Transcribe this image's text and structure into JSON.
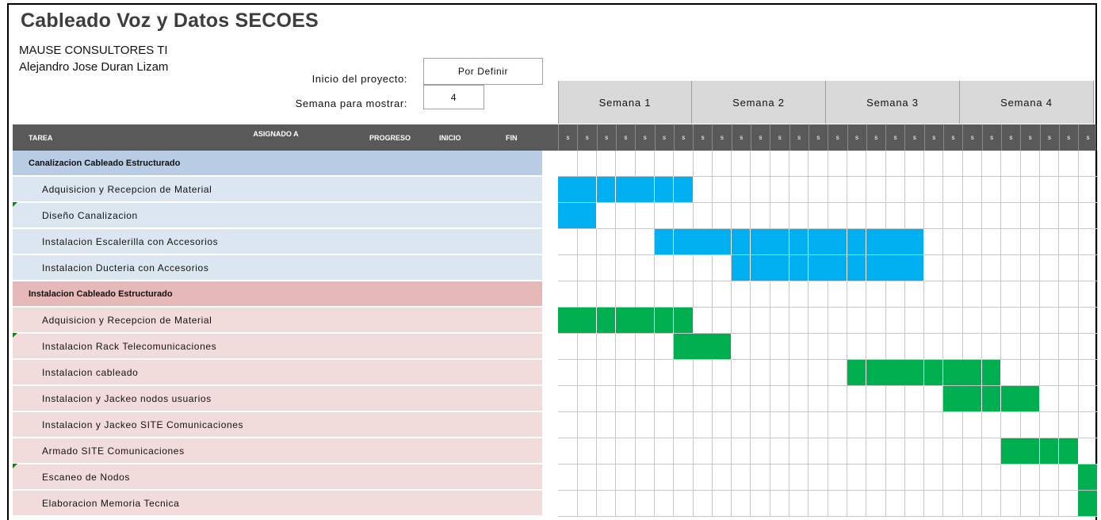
{
  "sheet": {
    "title": "Cableado Voz y Datos SECOES",
    "company": "MAUSE CONSULTORES TI",
    "manager": "Alejandro Jose Duran Lizam",
    "start_label": "Inicio del proyecto:",
    "start_value": "Por Definir",
    "week_label": "Semana para mostrar:",
    "week_value": "4"
  },
  "weeks": [
    "Semana 1",
    "Semana 2",
    "Semana 3",
    "Semana 4"
  ],
  "day_letter": "s",
  "columns": {
    "task": "TAREA",
    "assigned": "ASIGNADO A",
    "progress": "PROGRESO",
    "start": "INICIO",
    "end": "FIN"
  },
  "colors": {
    "blue_bar": "#00b0f0",
    "green_bar": "#00b050",
    "header_bg": "#595959"
  },
  "rows": [
    {
      "type": "section",
      "label": "Canalizacion Cableado Estructurado",
      "style": "blue"
    },
    {
      "type": "task",
      "label": "Adquisicion y Recepcion de Material",
      "style": "blue",
      "marker": false,
      "bar": [
        0,
        7
      ],
      "color": "blue"
    },
    {
      "type": "task",
      "label": "Diseño Canalizacion",
      "style": "blue",
      "marker": true,
      "bar": [
        0,
        2
      ],
      "color": "blue"
    },
    {
      "type": "task",
      "label": "Instalacion Escalerilla con Accesorios",
      "style": "blue",
      "marker": false,
      "bar": [
        5,
        14
      ],
      "color": "blue"
    },
    {
      "type": "task",
      "label": "Instalacion Ducteria con Accesorios",
      "style": "blue",
      "marker": false,
      "bar": [
        9,
        10
      ],
      "color": "blue"
    },
    {
      "type": "section",
      "label": "Instalacion Cableado Estructurado",
      "style": "red"
    },
    {
      "type": "task",
      "label": "Adquisicion y Recepcion de Material",
      "style": "red",
      "marker": false,
      "bar": [
        0,
        7
      ],
      "color": "green"
    },
    {
      "type": "task",
      "label": "Instalacion Rack Telecomunicaciones",
      "style": "red",
      "marker": true,
      "bar": [
        6,
        3
      ],
      "color": "green"
    },
    {
      "type": "task",
      "label": "Instalacion cableado",
      "style": "red",
      "marker": false,
      "bar": [
        15,
        8
      ],
      "color": "green"
    },
    {
      "type": "task",
      "label": "Instalacion y Jackeo nodos usuarios",
      "style": "red",
      "marker": false,
      "bar": [
        20,
        5
      ],
      "color": "green"
    },
    {
      "type": "task",
      "label": "Instalacion y Jackeo SITE Comunicaciones",
      "style": "red",
      "marker": false,
      "bar": null,
      "color": "green"
    },
    {
      "type": "task",
      "label": "Armado SITE Comunicaciones",
      "style": "red",
      "marker": false,
      "bar": [
        23,
        4
      ],
      "color": "green"
    },
    {
      "type": "task",
      "label": "Escaneo de Nodos",
      "style": "red",
      "marker": true,
      "bar": [
        27,
        1
      ],
      "color": "green"
    },
    {
      "type": "task",
      "label": "Elaboracion Memoria Tecnica",
      "style": "red",
      "marker": false,
      "bar": [
        27,
        1
      ],
      "color": "green"
    }
  ]
}
